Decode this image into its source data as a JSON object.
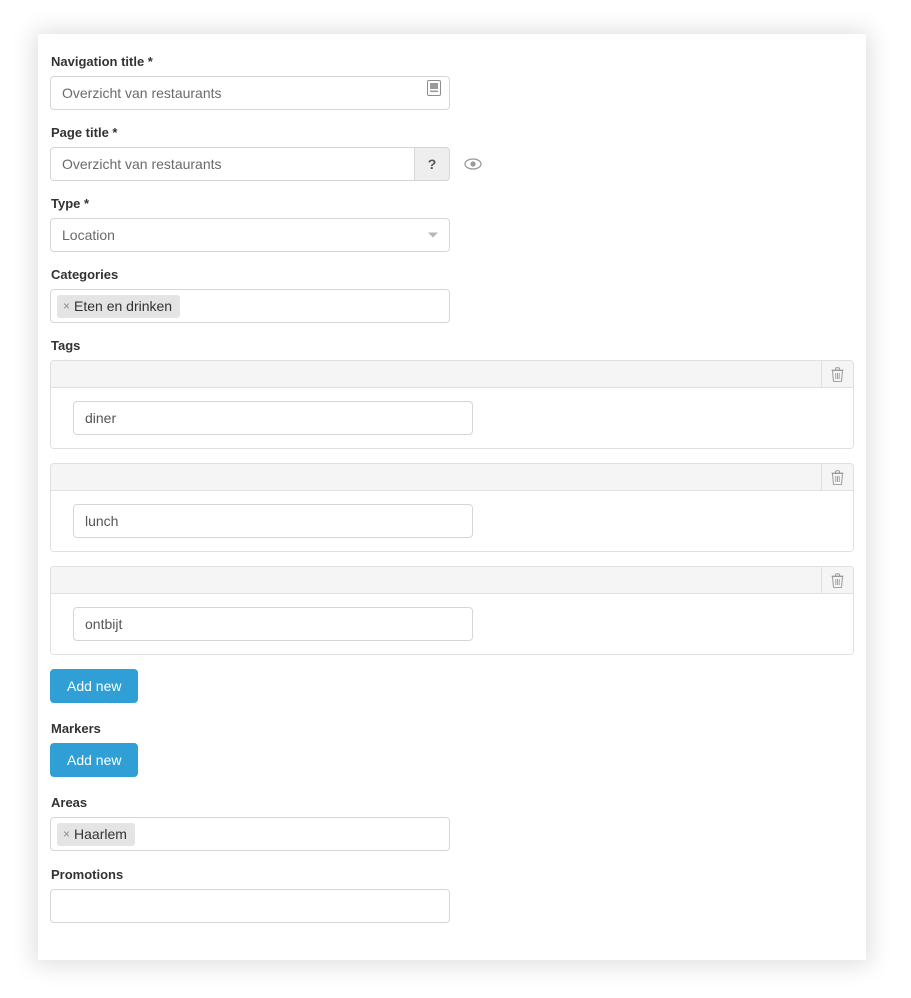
{
  "form": {
    "navigation_title": {
      "label": "Navigation title *",
      "value": "Overzicht van restaurants",
      "icon": "device-card-icon"
    },
    "page_title": {
      "label": "Page title *",
      "value": "Overzicht van restaurants",
      "help_button": "?",
      "preview_icon": "eye-icon"
    },
    "type": {
      "label": "Type *",
      "value": "Location",
      "caret": "chevron-down-icon"
    },
    "categories": {
      "label": "Categories",
      "chips": [
        {
          "remove": "×",
          "label": "Eten en drinken"
        }
      ]
    },
    "tags": {
      "label": "Tags",
      "items": [
        {
          "value": "diner",
          "delete_icon": "trash-icon"
        },
        {
          "value": "lunch",
          "delete_icon": "trash-icon"
        },
        {
          "value": "ontbijt",
          "delete_icon": "trash-icon"
        }
      ],
      "add_button": "Add new"
    },
    "markers": {
      "label": "Markers",
      "add_button": "Add new"
    },
    "areas": {
      "label": "Areas",
      "chips": [
        {
          "remove": "×",
          "label": "Haarlem"
        }
      ]
    },
    "promotions": {
      "label": "Promotions",
      "value": ""
    }
  },
  "colors": {
    "accent": "#2f9fd6",
    "panel_header": "#f5f5f5",
    "chip": "#e4e4e4",
    "border": "#d6d6d6",
    "text": "#333333"
  }
}
